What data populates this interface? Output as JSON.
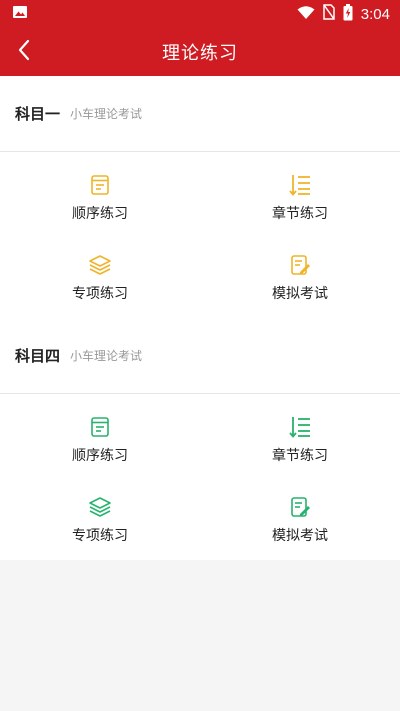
{
  "status": {
    "time": "3:04"
  },
  "appbar": {
    "title": "理论练习"
  },
  "sections": [
    {
      "title": "科目一",
      "subtitle": "小车理论考试",
      "color": "#f0b429",
      "items": [
        {
          "label": "顺序练习",
          "icon": "notepad-icon"
        },
        {
          "label": "章节练习",
          "icon": "list-sort-icon"
        },
        {
          "label": "专项练习",
          "icon": "layers-icon"
        },
        {
          "label": "模拟考试",
          "icon": "exam-paper-icon"
        }
      ]
    },
    {
      "title": "科目四",
      "subtitle": "小车理论考试",
      "color": "#27b36e",
      "items": [
        {
          "label": "顺序练习",
          "icon": "notepad-icon"
        },
        {
          "label": "章节练习",
          "icon": "list-sort-icon"
        },
        {
          "label": "专项练习",
          "icon": "layers-icon"
        },
        {
          "label": "模拟考试",
          "icon": "exam-paper-icon"
        }
      ]
    }
  ]
}
